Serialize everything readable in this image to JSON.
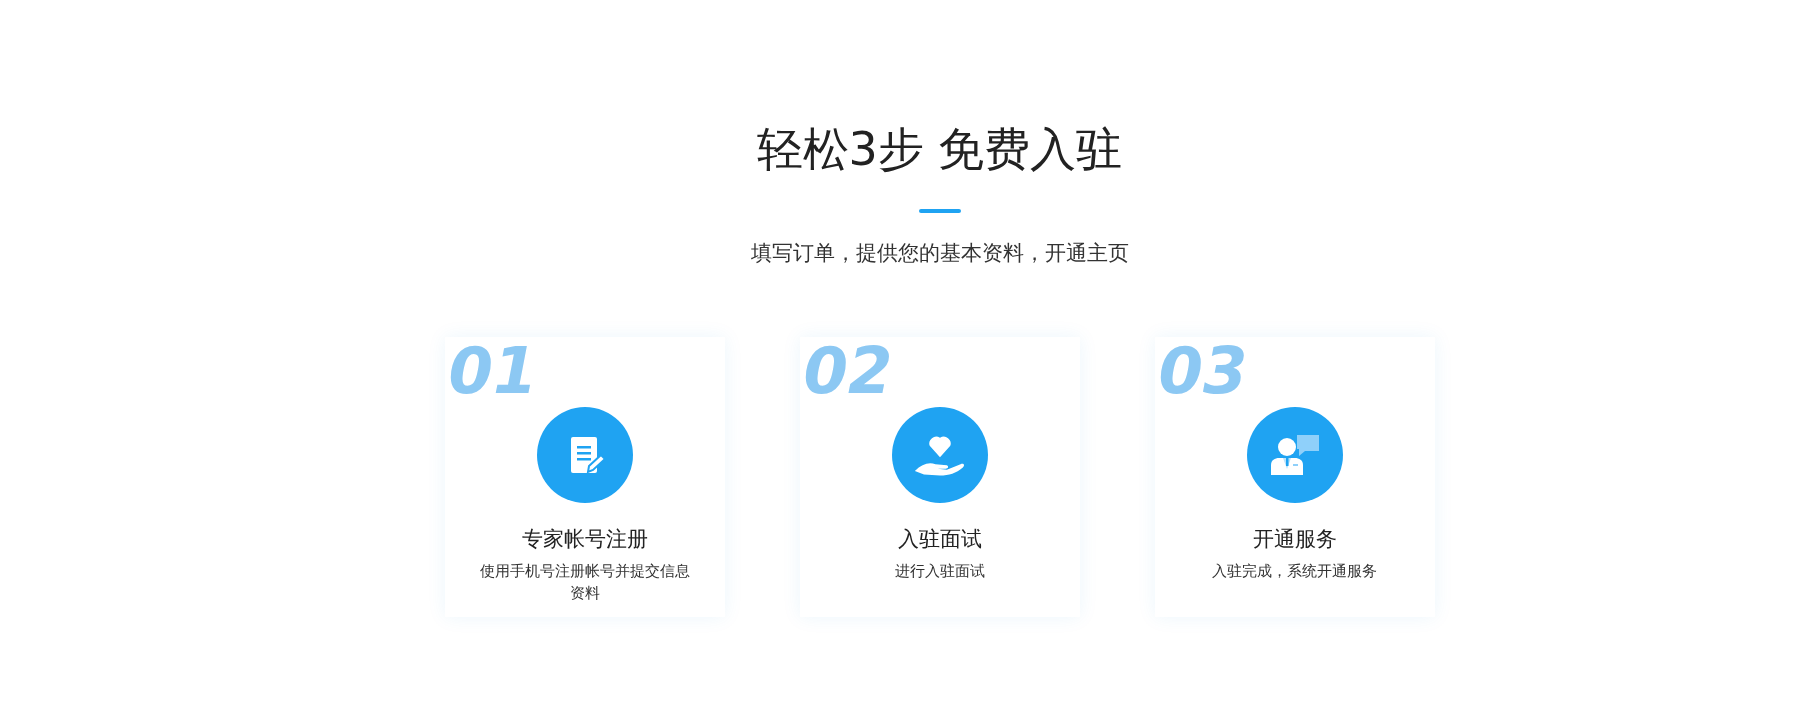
{
  "heading": {
    "title": "轻松3步 免费入驻",
    "subtitle": "填写订单，提供您的基本资料，开通主页"
  },
  "steps": [
    {
      "number": "01",
      "kind": "document",
      "title": "专家帐号注册",
      "description": "使用手机号注册帐号并提交信息资料"
    },
    {
      "number": "02",
      "kind": "heart",
      "title": "入驻面试",
      "description": "进行入驻面试"
    },
    {
      "number": "03",
      "kind": "person",
      "title": "开通服务",
      "description": "入驻完成，系统开通服务"
    }
  ]
}
